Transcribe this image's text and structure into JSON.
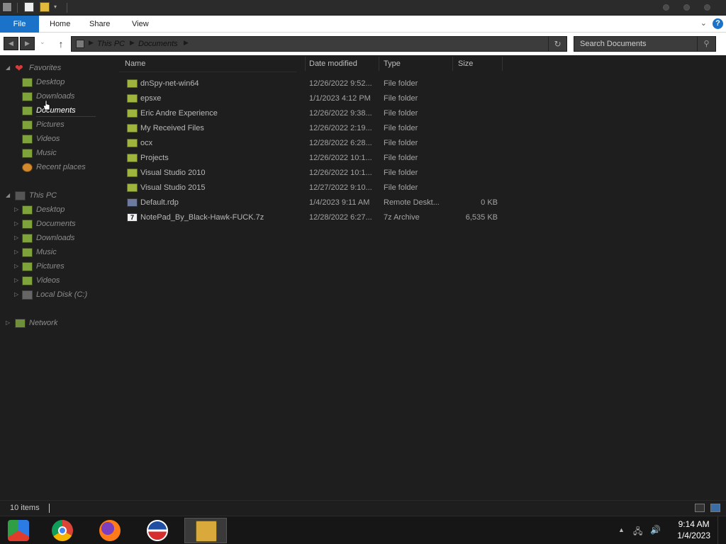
{
  "window": {
    "minimize_label": "",
    "maximize_label": "",
    "close_label": ""
  },
  "ribbon": {
    "tabs": [
      "File",
      "Home",
      "Share",
      "View"
    ],
    "help_label": "?"
  },
  "address": {
    "crumbs": [
      "This PC",
      "Documents"
    ]
  },
  "search": {
    "placeholder": "Search Documents"
  },
  "nav": {
    "favorites": {
      "label": "Favorites",
      "items": [
        "Desktop",
        "Downloads",
        "Documents",
        "Pictures",
        "Videos",
        "Music",
        "Recent places"
      ],
      "selected": "Documents"
    },
    "this_pc": {
      "label": "This PC",
      "items": [
        "Desktop",
        "Documents",
        "Downloads",
        "Music",
        "Pictures",
        "Videos",
        "Local Disk (C:)"
      ]
    },
    "network": {
      "label": "Network"
    }
  },
  "columns": {
    "name": "Name",
    "date": "Date modified",
    "type": "Type",
    "size": "Size"
  },
  "files": [
    {
      "name": "dnSpy-net-win64",
      "date": "12/26/2022 9:52...",
      "type": "File folder",
      "size": "",
      "icon": "folder-icon"
    },
    {
      "name": "epsxe",
      "date": "1/1/2023 4:12 PM",
      "type": "File folder",
      "size": "",
      "icon": "folder-icon"
    },
    {
      "name": "Eric Andre Experience",
      "date": "12/26/2022 9:38...",
      "type": "File folder",
      "size": "",
      "icon": "folder-icon"
    },
    {
      "name": "My Received Files",
      "date": "12/26/2022 2:19...",
      "type": "File folder",
      "size": "",
      "icon": "folder-icon"
    },
    {
      "name": "ocx",
      "date": "12/28/2022 6:28...",
      "type": "File folder",
      "size": "",
      "icon": "folder-icon"
    },
    {
      "name": "Projects",
      "date": "12/26/2022 10:1...",
      "type": "File folder",
      "size": "",
      "icon": "folder-icon"
    },
    {
      "name": "Visual Studio 2010",
      "date": "12/26/2022 10:1...",
      "type": "File folder",
      "size": "",
      "icon": "folder-icon"
    },
    {
      "name": "Visual Studio 2015",
      "date": "12/27/2022 9:10...",
      "type": "File folder",
      "size": "",
      "icon": "folder-icon"
    },
    {
      "name": "Default.rdp",
      "date": "1/4/2023 9:11 AM",
      "type": "Remote Deskt...",
      "size": "0 KB",
      "icon": "rdp-file-icon"
    },
    {
      "name": "NotePad_By_Black-Hawk-FUCK.7z",
      "date": "12/28/2022 6:27...",
      "type": "7z Archive",
      "size": "6,535 KB",
      "icon": "7z-archive-icon"
    }
  ],
  "status": {
    "count": "10 items"
  },
  "taskbar": {
    "apps": [
      "chromium-icon",
      "chrome-icon",
      "firefox-icon",
      "obama-logo-icon",
      "file-explorer-icon"
    ],
    "time": "9:14 AM",
    "date": "1/4/2023"
  },
  "colors": {
    "accent": "#1a73c8",
    "background": "#1e1e1e",
    "folder": "#9fb43e"
  }
}
